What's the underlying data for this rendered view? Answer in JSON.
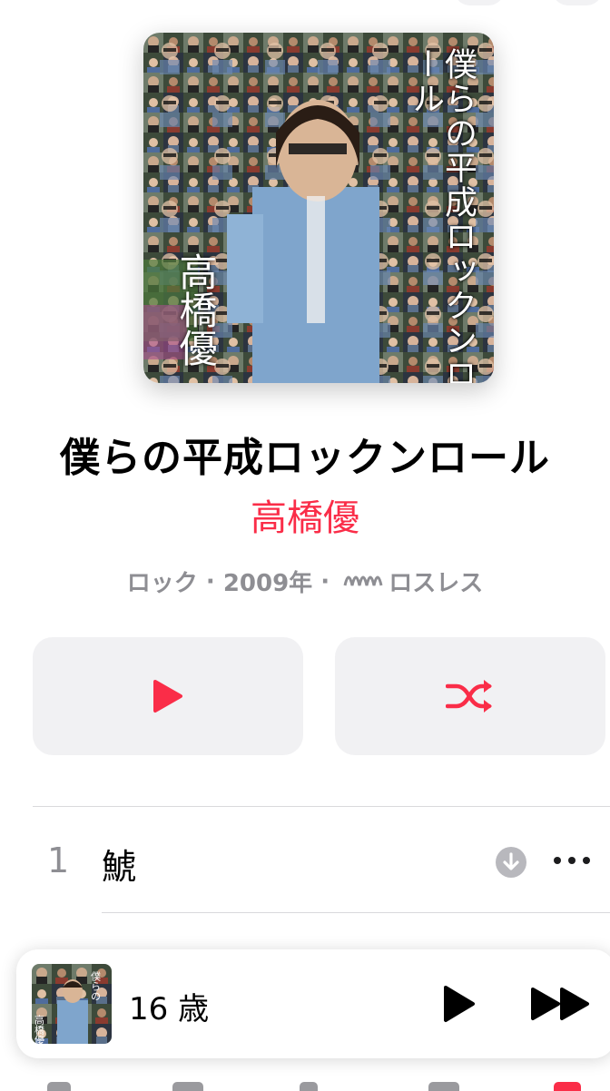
{
  "album": {
    "title": "僕らの平成ロックンロール",
    "artist": "高橋優",
    "genre": "ロック",
    "year": "2009年",
    "separator": "·",
    "quality": "ロスレス",
    "artwork": {
      "title_text": "僕らの平成ロックンロール",
      "artist_text": "高橋優"
    }
  },
  "actions": {
    "play_icon": "play-icon",
    "shuffle_icon": "shuffle-icon"
  },
  "tracks": [
    {
      "number": "1",
      "name": "鯱"
    }
  ],
  "mini_player": {
    "now_playing": "16 歳",
    "play_icon": "play-icon",
    "forward_icon": "fast-forward-icon"
  },
  "colors": {
    "accent": "#fa2d48",
    "secondary_text": "#8e8e93",
    "button_bg": "#f1f1f3"
  }
}
